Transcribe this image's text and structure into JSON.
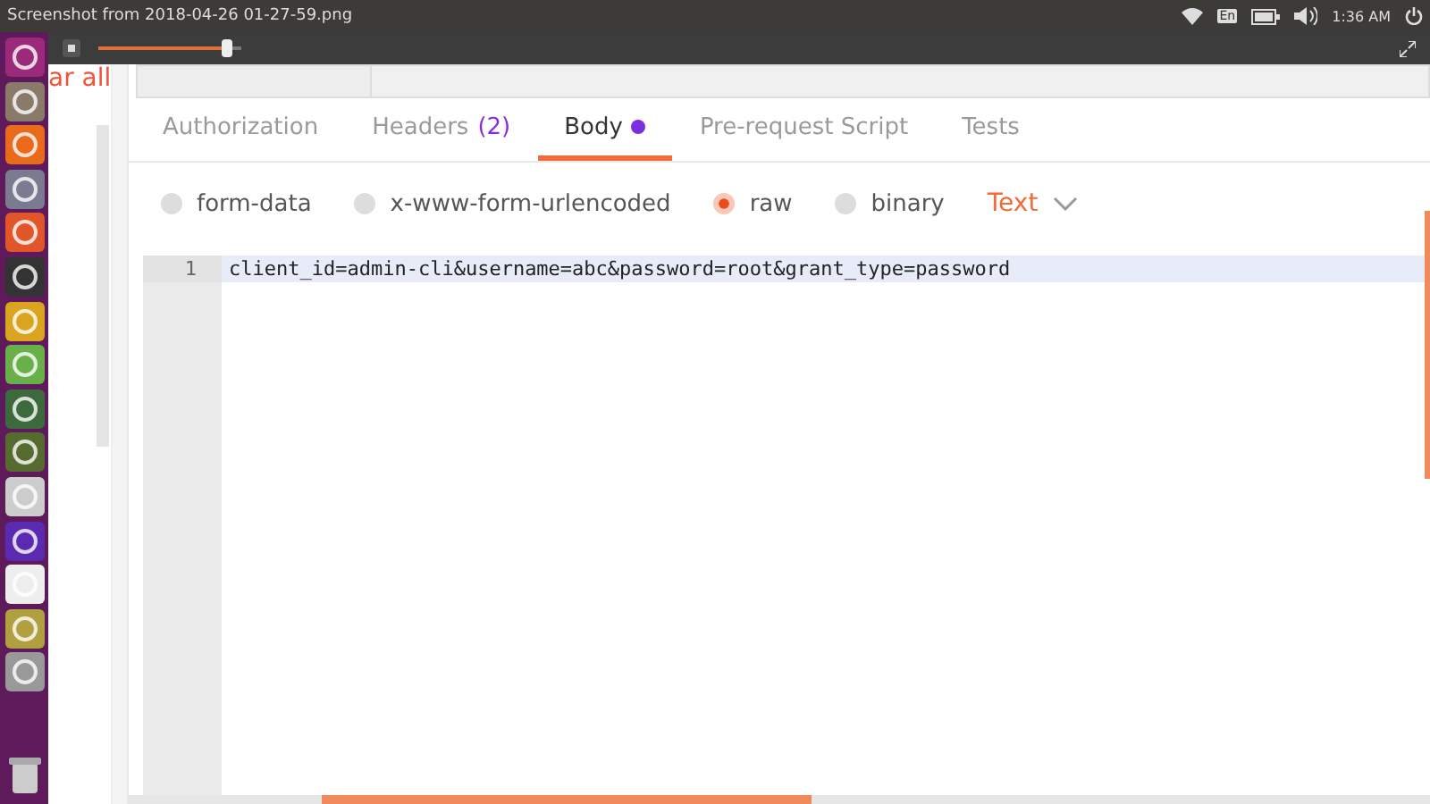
{
  "top_bar": {
    "title": "Screenshot from 2018-04-26 01-27-59.png",
    "keyboard": "En",
    "clock": "1:36 AM"
  },
  "viewer": {
    "zoom_slider": {
      "level": 0.9
    }
  },
  "sidebar": {
    "link": "ar all"
  },
  "tabs": [
    {
      "label": "Authorization",
      "selected": false
    },
    {
      "label": "Headers",
      "count": "(2)",
      "selected": false
    },
    {
      "label": "Body",
      "dot": true,
      "selected": true
    },
    {
      "label": "Pre-request Script",
      "selected": false
    },
    {
      "label": "Tests",
      "selected": false
    }
  ],
  "body_types": [
    {
      "label": "form-data",
      "selected": false
    },
    {
      "label": "x-www-form-urlencoded",
      "selected": false
    },
    {
      "label": "raw",
      "selected": true
    },
    {
      "label": "binary",
      "selected": false
    }
  ],
  "format_dropdown": {
    "value": "Text"
  },
  "editor": {
    "lines": [
      {
        "number": "1",
        "text": "client_id=admin-cli&username=abc&password=root&grant_type=password",
        "highlighted": true
      }
    ]
  }
}
